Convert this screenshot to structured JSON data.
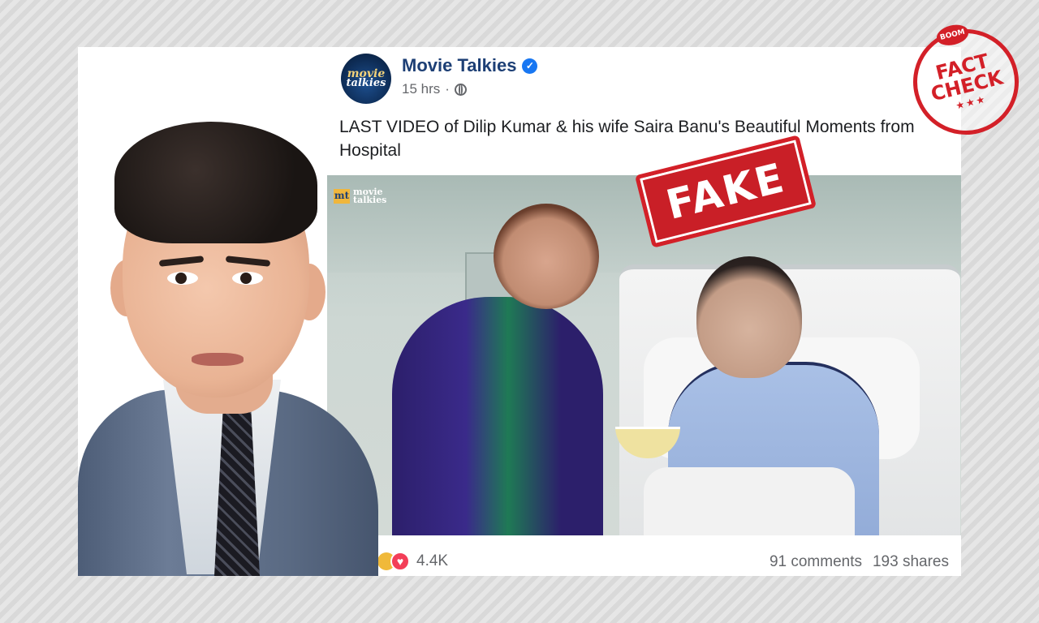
{
  "post": {
    "page_name": "Movie Talkies",
    "verified_icon": "verified-check-icon",
    "time": "15 hrs",
    "separator": "·",
    "privacy_icon": "globe-icon",
    "text": "LAST VIDEO of Dilip Kumar & his wife Saira Banu's Beautiful Moments from Hospital",
    "avatar_text": [
      "movie",
      "talkies"
    ]
  },
  "video": {
    "watermark": [
      "movie",
      "talkies"
    ],
    "watermark_mark": "mt"
  },
  "overlays": {
    "fake_stamp": "FAKE",
    "seal_brand": "BOOM",
    "seal_line1": "FACT",
    "seal_line2": "CHECK",
    "seal_stars": "★★★"
  },
  "engagement": {
    "reactions": "4.4K",
    "comments": "91 comments",
    "shares": "193 shares"
  },
  "colors": {
    "facebook_blue": "#1877f2",
    "stamp_red": "#d32028",
    "page_name": "#1d3f75"
  }
}
